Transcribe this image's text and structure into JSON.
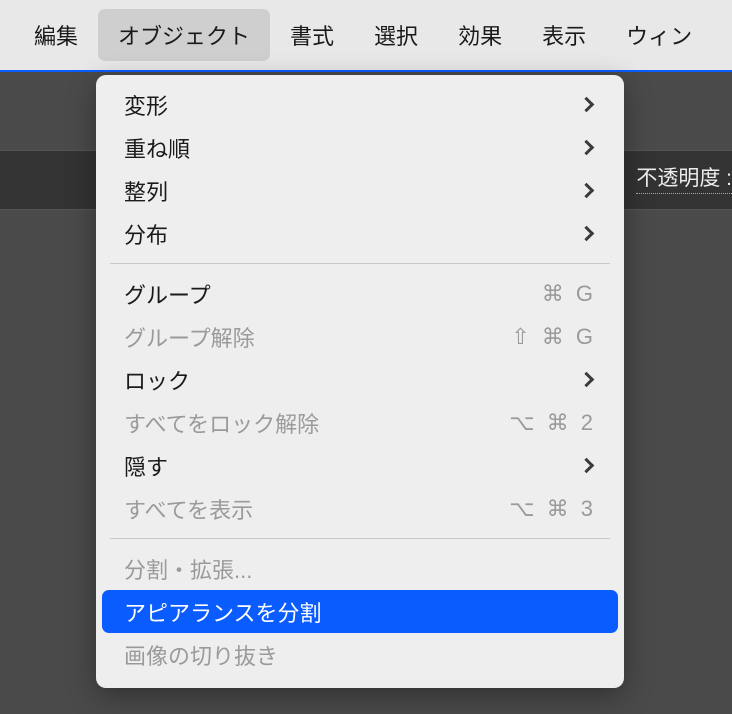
{
  "menubar": {
    "items": [
      {
        "label": "編集",
        "active": false
      },
      {
        "label": "オブジェクト",
        "active": true
      },
      {
        "label": "書式",
        "active": false
      },
      {
        "label": "選択",
        "active": false
      },
      {
        "label": "効果",
        "active": false
      },
      {
        "label": "表示",
        "active": false
      },
      {
        "label": "ウィン",
        "active": false
      }
    ]
  },
  "toolbar": {
    "opacity_label": "不透明度 :"
  },
  "dropdown": {
    "items": [
      {
        "label": "変形",
        "submenu": true,
        "disabled": false
      },
      {
        "label": "重ね順",
        "submenu": true,
        "disabled": false
      },
      {
        "label": "整列",
        "submenu": true,
        "disabled": false
      },
      {
        "label": "分布",
        "submenu": true,
        "disabled": false
      },
      {
        "separator": true
      },
      {
        "label": "グループ",
        "shortcut": "⌘ G",
        "disabled": false
      },
      {
        "label": "グループ解除",
        "shortcut": "⇧ ⌘ G",
        "disabled": true
      },
      {
        "label": "ロック",
        "submenu": true,
        "disabled": false
      },
      {
        "label": "すべてをロック解除",
        "shortcut": "⌥ ⌘ 2",
        "disabled": true
      },
      {
        "label": "隠す",
        "submenu": true,
        "disabled": false
      },
      {
        "label": "すべてを表示",
        "shortcut": "⌥ ⌘ 3",
        "disabled": true
      },
      {
        "separator": true
      },
      {
        "label": "分割・拡張...",
        "disabled": true
      },
      {
        "label": "アピアランスを分割",
        "disabled": false,
        "highlighted": true
      },
      {
        "label": "画像の切り抜き",
        "disabled": true
      }
    ]
  }
}
